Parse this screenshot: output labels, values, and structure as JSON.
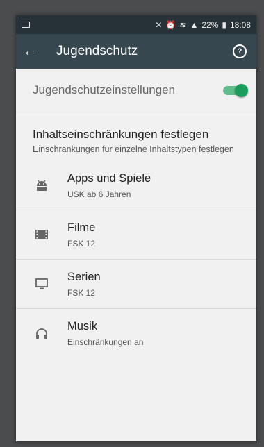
{
  "status": {
    "battery": "22%",
    "time": "18:08"
  },
  "toolbar": {
    "title": "Jugendschutz"
  },
  "parental_switch": {
    "label": "Jugendschutzeinstellungen",
    "enabled": true
  },
  "section": {
    "title": "Inhaltseinschränkungen festlegen",
    "subtitle": "Einschränkungen für einzelne Inhaltstypen festlegen"
  },
  "items": [
    {
      "title": "Apps und Spiele",
      "subtitle": "USK ab 6 Jahren",
      "icon": "android-icon"
    },
    {
      "title": "Filme",
      "subtitle": "FSK 12",
      "icon": "film-icon"
    },
    {
      "title": "Serien",
      "subtitle": "FSK 12",
      "icon": "tv-icon"
    },
    {
      "title": "Musik",
      "subtitle": "Einschränkungen an",
      "icon": "headphones-icon"
    }
  ],
  "colors": {
    "toolbar": "#37474f",
    "statusbar": "#263238",
    "accent": "#1b9b5c"
  }
}
